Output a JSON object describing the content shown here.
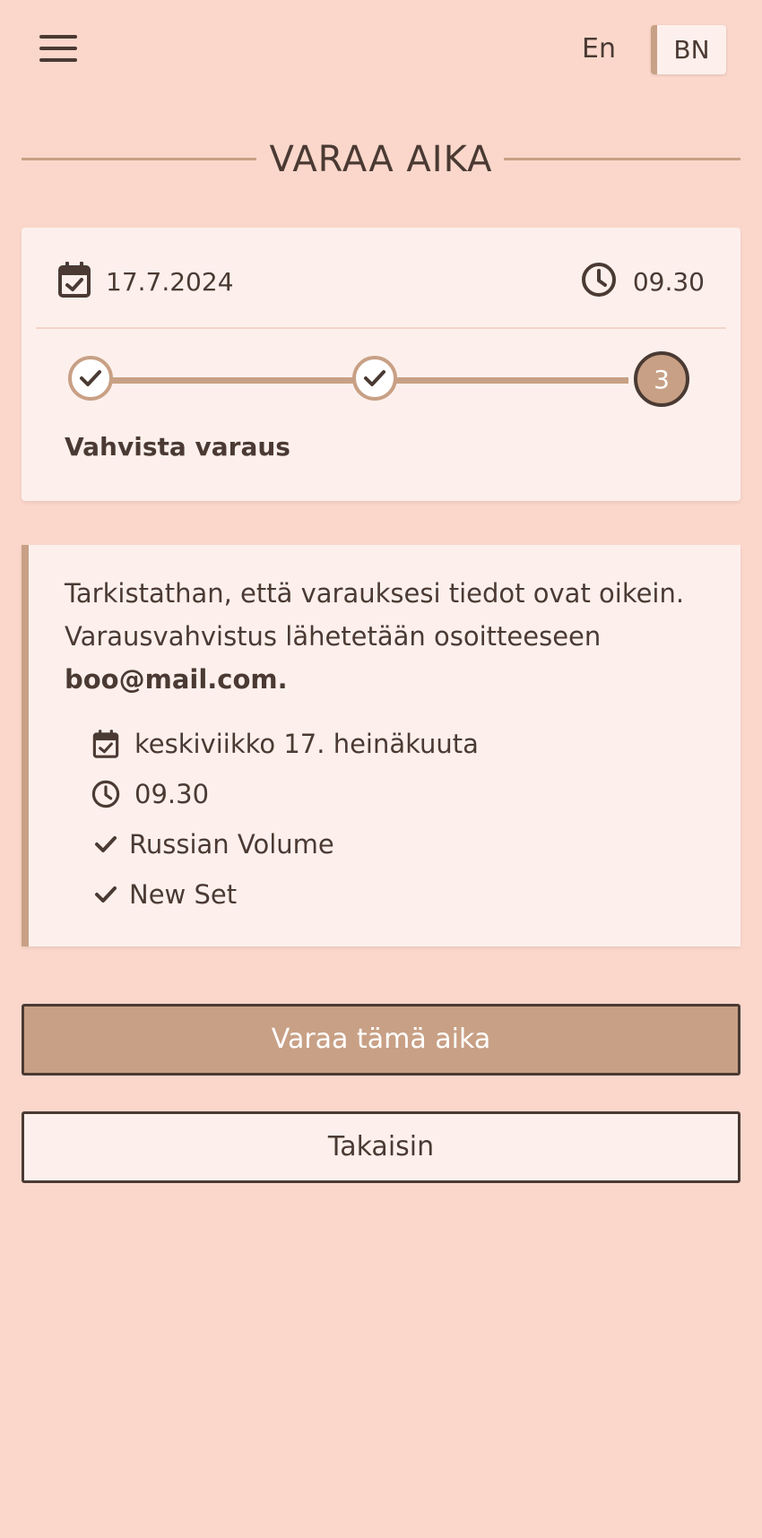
{
  "header": {
    "lang_en": "En",
    "lang_bn": "BN"
  },
  "page": {
    "title": "VARAA AIKA"
  },
  "summary": {
    "date": "17.7.2024",
    "time": "09.30",
    "steps": [
      "✓",
      "✓",
      "3"
    ],
    "current_step_label": "Vahvista varaus"
  },
  "confirmation": {
    "text": "Tarkistathan, että varauksesi tiedot ovat oikein. Varausvahvistus lähetetään osoitteeseen",
    "email": "boo@mail.com.",
    "date_long": "keskiviikko 17. heinäkuuta",
    "time": "09.30",
    "services": [
      "Russian Volume",
      "New Set"
    ]
  },
  "actions": {
    "book_label": "Varaa tämä aika",
    "back_label": "Takaisin"
  },
  "colors": {
    "background": "#fbd7cb",
    "card": "#fdf0ec",
    "accent": "#c8a085",
    "text": "#4a3a33"
  }
}
